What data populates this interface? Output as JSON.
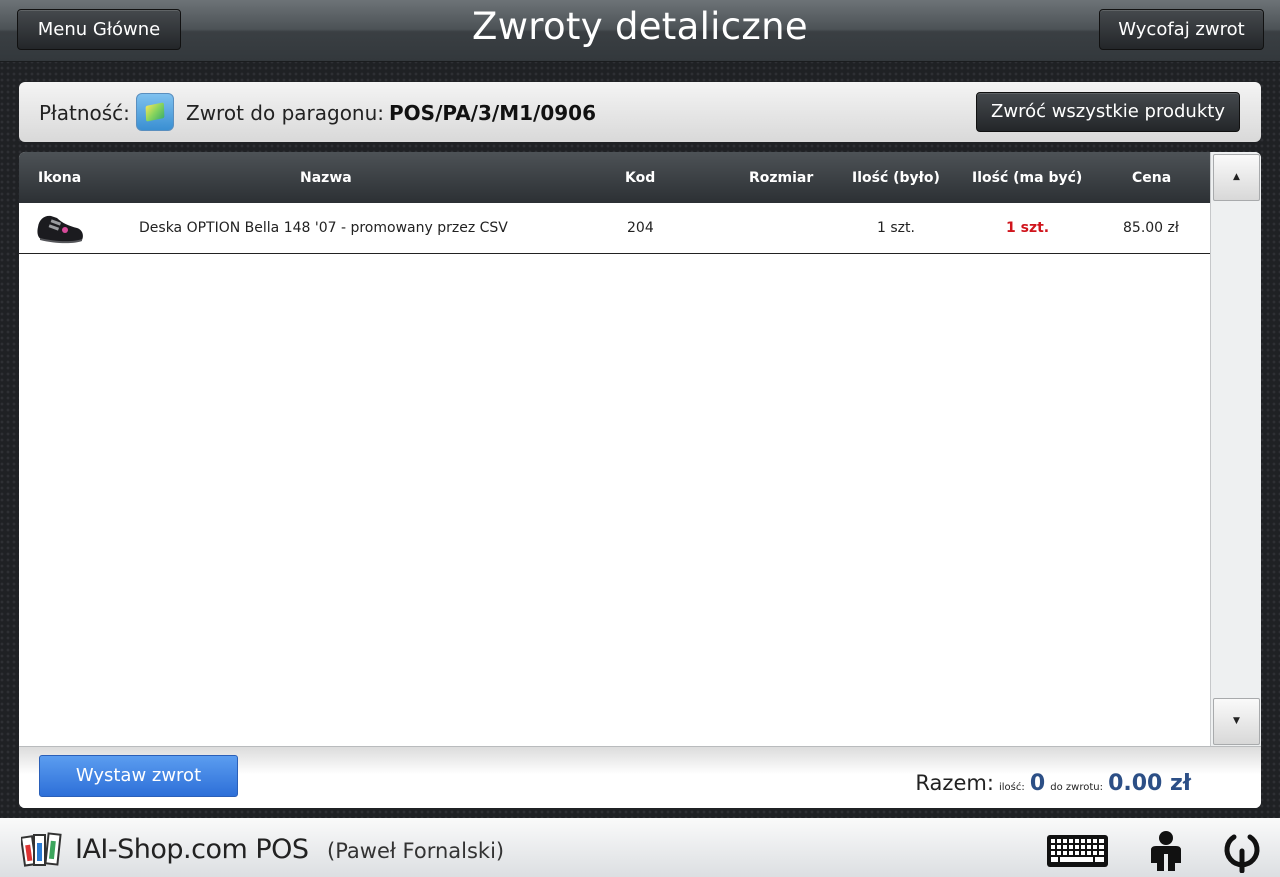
{
  "header": {
    "title": "Zwroty detaliczne",
    "menu_button": "Menu Główne",
    "withdraw_button": "Wycofaj zwrot"
  },
  "payment_bar": {
    "payment_label": "Płatność:",
    "payment_icon": "cash-cube-icon",
    "return_label": "Zwrot do paragonu:",
    "receipt_number": "POS/PA/3/M1/0906",
    "return_all_button": "Zwróć wszystkie produkty"
  },
  "table": {
    "columns": [
      "Ikona",
      "Nazwa",
      "Kod",
      "Rozmiar",
      "Ilość (było)",
      "Ilość (ma być)",
      "Cena"
    ],
    "rows": [
      {
        "icon": "shoe-icon",
        "name": "Deska OPTION Bella 148 '07 - promowany przez CSV",
        "code": "204",
        "size": "",
        "qty_was": "1 szt.",
        "qty_should": "1 szt.",
        "price": "85.00 zł"
      }
    ]
  },
  "footer": {
    "issue_button": "Wystaw zwrot",
    "total_label": "Razem:",
    "qty_label": "ilość:",
    "qty_value": "0",
    "to_return_label": "do zwrotu:",
    "to_return_value": "0.00 zł"
  },
  "statusbar": {
    "app_name": "IAI-Shop.com POS",
    "user": "(Paweł Fornalski)"
  },
  "colors": {
    "accent_blue": "#2d6fd8",
    "qty_red": "#d0141c",
    "total_blue": "#2c4f86"
  }
}
